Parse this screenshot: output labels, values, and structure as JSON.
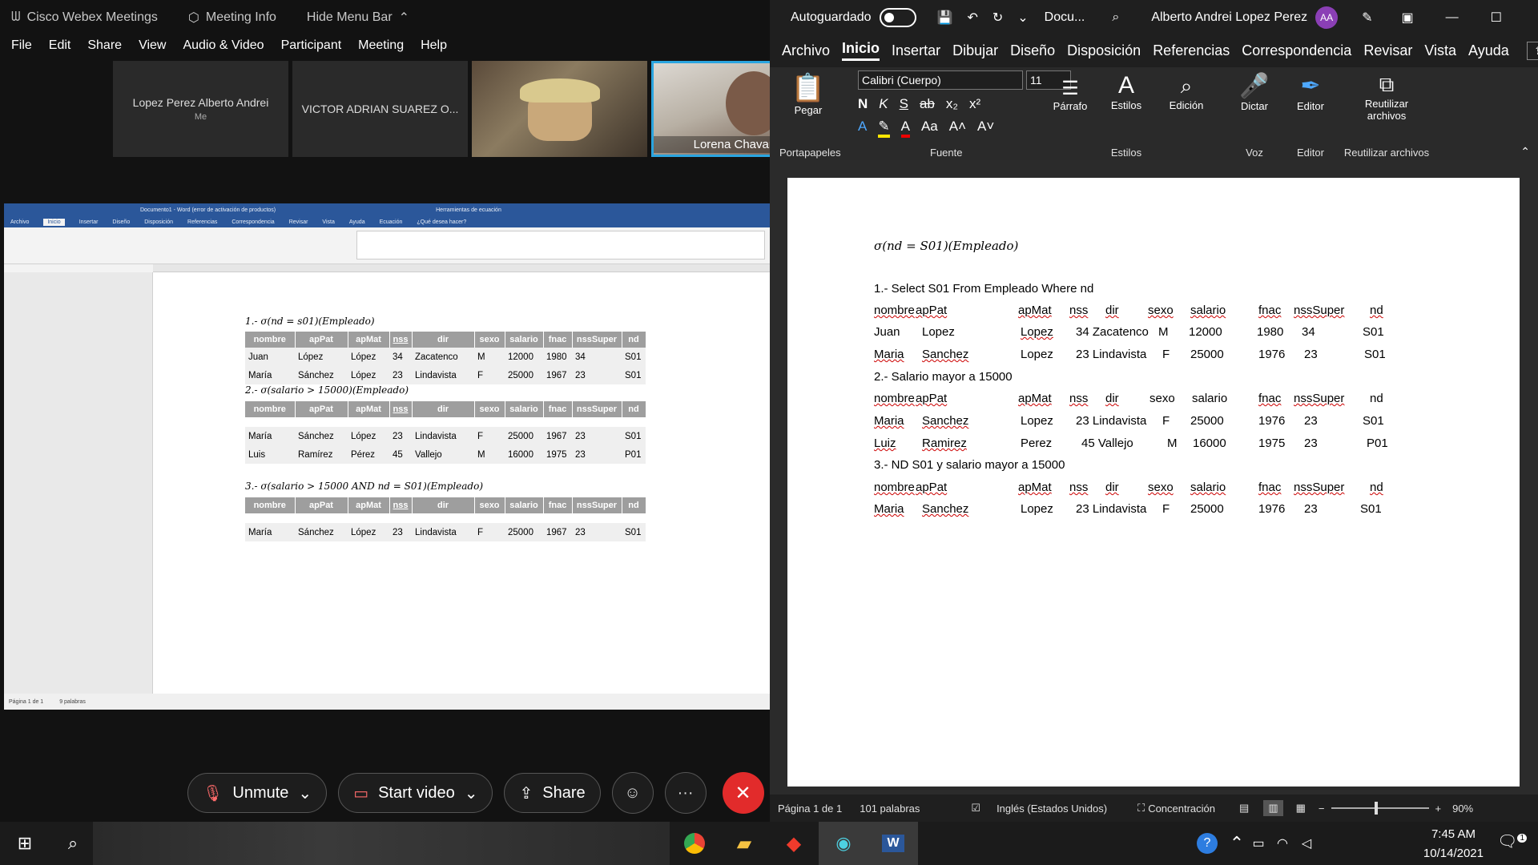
{
  "webex": {
    "title": "Cisco Webex Meetings",
    "meeting_info": "Meeting Info",
    "hide_menu": "Hide Menu Bar",
    "menu": [
      "File",
      "Edit",
      "Share",
      "View",
      "Audio & Video",
      "Participant",
      "Meeting",
      "Help"
    ],
    "participants": [
      {
        "name": "Lopez Perez Alberto Andrei",
        "sub": "Me"
      },
      {
        "name": "VICTOR ADRIAN SUAREZ O..."
      },
      {
        "name": ""
      },
      {
        "name": "Lorena Chavarría"
      }
    ],
    "controls": {
      "unmute": "Unmute",
      "start_video": "Start video",
      "share": "Share",
      "more": "···"
    }
  },
  "shared_doc": {
    "title": "Documento1 - Word (error de activación de productos)",
    "context": "Herramientas de ecuación",
    "tabs": [
      "Archivo",
      "Inicio",
      "Insertar",
      "Diseño",
      "Disposición",
      "Referencias",
      "Correspondencia",
      "Revisar",
      "Vista",
      "Ayuda",
      "Ecuación"
    ],
    "tell_me": "¿Qué desea hacer?",
    "status": [
      "Página 1 de 1",
      "9 palabras"
    ],
    "queries": [
      "1.- σ(nd = s01)(Empleado)",
      "2.- σ(salario > 15000)(Empleado)",
      "3.- σ(salario > 15000 AND nd = S01)(Empleado)"
    ],
    "columns": [
      "nombre",
      "apPat",
      "apMat",
      "nss",
      "dir",
      "sexo",
      "salario",
      "fnac",
      "nssSuper",
      "nd"
    ],
    "tables": [
      [
        [
          "Juan",
          "López",
          "López",
          "34",
          "Zacatenco",
          "M",
          "12000",
          "1980",
          "34",
          "S01"
        ],
        [
          "María",
          "Sánchez",
          "López",
          "23",
          "Lindavista",
          "F",
          "25000",
          "1967",
          "23",
          "S01"
        ]
      ],
      [
        [
          "María",
          "Sánchez",
          "López",
          "23",
          "Lindavista",
          "F",
          "25000",
          "1967",
          "23",
          "S01"
        ],
        [
          "Luis",
          "Ramírez",
          "Pérez",
          "45",
          "Vallejo",
          "M",
          "16000",
          "1975",
          "23",
          "P01"
        ]
      ],
      [
        [
          "María",
          "Sánchez",
          "López",
          "23",
          "Lindavista",
          "F",
          "25000",
          "1967",
          "23",
          "S01"
        ]
      ]
    ]
  },
  "word": {
    "autosave": "Autoguardado",
    "doc_name": "Docu...",
    "user": "Alberto Andrei Lopez Perez",
    "initials": "AA",
    "tabs": [
      "Archivo",
      "Inicio",
      "Insertar",
      "Dibujar",
      "Diseño",
      "Disposición",
      "Referencias",
      "Correspondencia",
      "Revisar",
      "Vista",
      "Ayuda"
    ],
    "font": "Calibri (Cuerpo)",
    "font_size": "11",
    "groups": {
      "paste": "Pegar",
      "clipboard": "Portapapeles",
      "font": "Fuente",
      "paragraph": "Párrafo",
      "styles": "Estilos",
      "styles_group": "Estilos",
      "editing": "Edición",
      "dictate": "Dictar",
      "voice": "Voz",
      "editor": "Editor",
      "editor_group": "Editor",
      "reuse": "Reutilizar archivos",
      "reuse_group": "Reutilizar archivos"
    },
    "doc_lines": {
      "formula": "σ(nd = S01)(Empleado)",
      "q1": "1.- Select S01 From Empleado Where nd",
      "q2": "2.- Salario mayor a 15000",
      "q3": "3.- ND S01 y salario mayor a 15000",
      "header": [
        "nombre",
        "apPat",
        "apMat",
        "nss",
        "dir",
        "sexo",
        "salario",
        "fnac",
        "nssSuper",
        "nd"
      ],
      "r1": [
        "Juan",
        "Lopez",
        "Lopez",
        "34 Zacatenco",
        "M",
        "12000",
        "1980",
        "34",
        "S01"
      ],
      "r2": [
        "Maria",
        "Sanchez",
        "Lopez",
        "23 Lindavista",
        "F",
        "25000",
        "1976",
        "23",
        "S01"
      ],
      "r3": [
        "Maria",
        "Sanchez",
        "Lopez",
        "23 Lindavista",
        "F",
        "25000",
        "1976",
        "23",
        "S01"
      ],
      "r4": [
        "Luiz",
        "Ramirez",
        "Perez",
        "45 Vallejo",
        "M",
        "16000",
        "1975",
        "23",
        "P01"
      ],
      "r5": [
        "Maria",
        "Sanchez",
        "Lopez",
        "23 Lindavista",
        "F",
        "25000",
        "1976",
        "23",
        "S01"
      ]
    },
    "status": {
      "page": "Página 1 de 1",
      "words": "101 palabras",
      "lang": "Inglés (Estados Unidos)",
      "focus": "Concentración",
      "zoom": "90%"
    }
  },
  "taskbar": {
    "time": "7:45 AM",
    "date": "10/14/2021",
    "notif": "1"
  }
}
